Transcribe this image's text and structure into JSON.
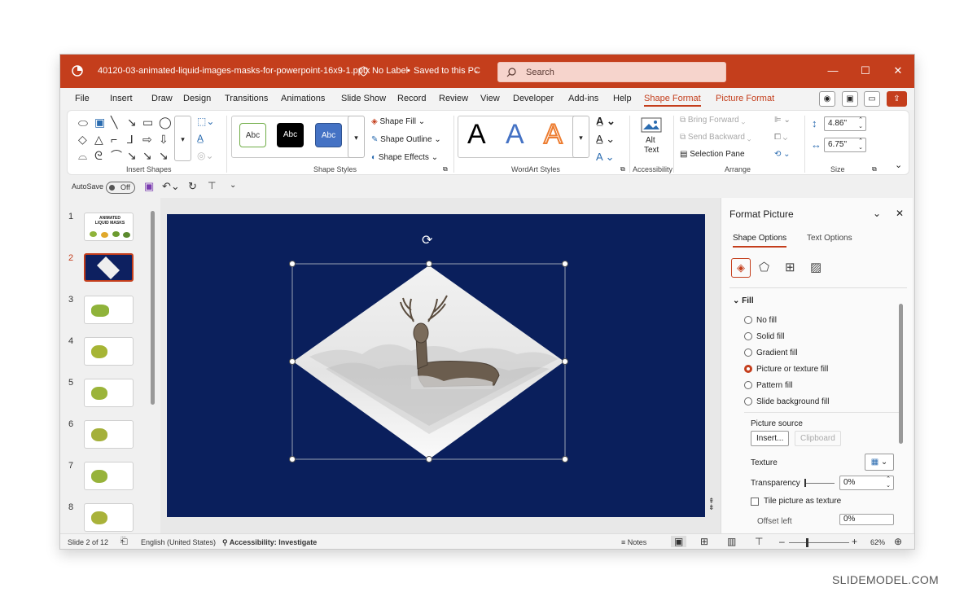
{
  "titlebar": {
    "filename": "40120-03-animated-liquid-images-masks-for-powerpoint-16x9-1.pptx",
    "label": "No Label",
    "saved": "Saved to this PC",
    "search_placeholder": "Search",
    "bg_color": "#c43e1c"
  },
  "menu": {
    "items": [
      "File",
      "Insert",
      "Draw",
      "Design",
      "Transitions",
      "Animations",
      "Slide Show",
      "Record",
      "Review",
      "View",
      "Developer",
      "Add-ins",
      "Help"
    ],
    "active": "Shape Format",
    "picture_format": "Picture Format"
  },
  "ribbon": {
    "insert_shapes_label": "Insert Shapes",
    "shape_styles_label": "Shape Styles",
    "style_sample": "Abc",
    "shape_fill": "Shape Fill",
    "shape_outline": "Shape Outline",
    "shape_effects": "Shape Effects",
    "wordart_letter": "A",
    "wordart_label": "WordArt Styles",
    "alt_text": "Alt Text",
    "alt_text_1": "Alt",
    "alt_text_2": "Text",
    "accessibility_label": "Accessibility",
    "bring_forward": "Bring Forward",
    "send_backward": "Send Backward",
    "selection_pane": "Selection Pane",
    "arrange_label": "Arrange",
    "height": "4.86\"",
    "width": "6.75\"",
    "size_label": "Size"
  },
  "qat": {
    "autosave": "AutoSave",
    "toggle": "Off"
  },
  "thumbnails": {
    "numbers": [
      "1",
      "2",
      "3",
      "4",
      "5",
      "6",
      "7",
      "8"
    ],
    "slide1_title": "ANIMATED LIQUID MASKS"
  },
  "panel": {
    "title": "Format Picture",
    "tab_shape": "Shape Options",
    "tab_text": "Text Options",
    "section_fill": "Fill",
    "options": [
      "No fill",
      "Solid fill",
      "Gradient fill",
      "Picture or texture fill",
      "Pattern fill",
      "Slide background fill"
    ],
    "selected_option": "Picture or texture fill",
    "picture_source": "Picture source",
    "insert_btn": "Insert...",
    "clipboard_btn": "Clipboard",
    "texture": "Texture",
    "transparency": "Transparency",
    "transparency_value": "0%",
    "tile": "Tile picture as texture",
    "offset_left": "Offset left",
    "offset_value": "0%"
  },
  "status": {
    "slide": "Slide 2 of 12",
    "language": "English (United States)",
    "accessibility": "Accessibility: Investigate",
    "notes": "Notes",
    "zoom": "62%"
  },
  "watermark": "SLIDEMODEL.COM",
  "colors": {
    "accent": "#c43e1c",
    "slide_bg": "#0a1f5c"
  }
}
